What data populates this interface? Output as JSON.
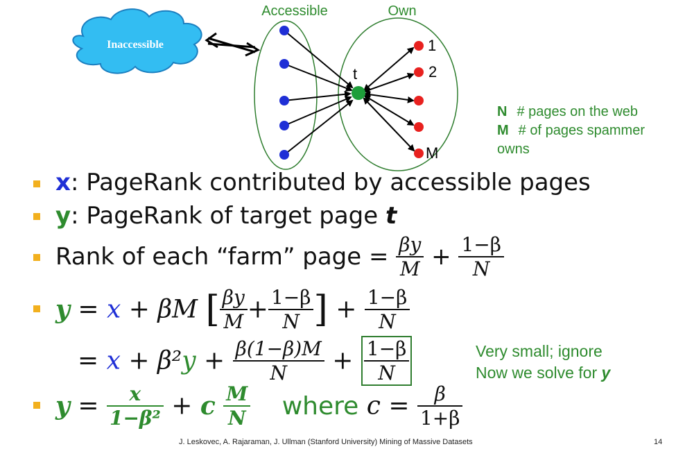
{
  "diagram": {
    "inaccessible_label": "Inaccessible",
    "accessible_label": "Accessible",
    "own_label": "Own",
    "target_label": "t",
    "farm_labels": [
      "1",
      "2",
      "M"
    ]
  },
  "legend": {
    "n_key": "N",
    "n_text": "# pages on the web",
    "m_key": "M",
    "m_text": "# of pages spammer",
    "m_text2": "owns"
  },
  "bullets": {
    "b1_var": "x",
    "b1_text": ": PageRank contributed by accessible pages",
    "b2_var": "y",
    "b2_text": ": PageRank of target page ",
    "b2_t": "t",
    "b3_text": "Rank of each “farm” page = ",
    "b3_num1": "βy",
    "b3_den1": "M",
    "b3_plus": "+",
    "b3_num2": "1−β",
    "b3_den2": "N",
    "eq1_lhs": "y",
    "eq1_eq": " = ",
    "eq1_x": "x",
    "eq1_rest": " + βM",
    "eq1_num_a": "βy",
    "eq1_den_a": "M",
    "eq1_num_b": "1−β",
    "eq1_den_b": "N",
    "eq1_num_c": "1−β",
    "eq1_den_c": "N",
    "eq2_eq": "= ",
    "eq2_x": "x",
    "eq2_mid": " + β²",
    "eq2_y": "y",
    "eq2_num": "β(1−β)M",
    "eq2_den": "N",
    "eq2_num_box": "1−β",
    "eq2_den_box": "N",
    "eq3_lhs": "y",
    "eq3_num1": "x",
    "eq3_den1": "1−β²",
    "eq3_c": "c",
    "eq3_num2": "M",
    "eq3_den2": "N",
    "eq3_where": "where ",
    "eq3_c2": "c",
    "eq3_num3": "β",
    "eq3_den3": "1+β"
  },
  "note": {
    "line1": "Very small; ignore",
    "line2_prefix": "Now we solve for ",
    "line2_var": "y"
  },
  "footer": {
    "citation": "J. Leskovec, A. Rajaraman, J. Ullman (Stanford University) Mining of Massive Datasets",
    "page": "14"
  },
  "colors": {
    "accessible_node": "#1F2FD6",
    "target_node": "#1E9E3A",
    "farm_node": "#E8211F",
    "cloud": "#33BDF2",
    "bullet": "#F2B01E",
    "green_text": "#2E8B2E"
  }
}
